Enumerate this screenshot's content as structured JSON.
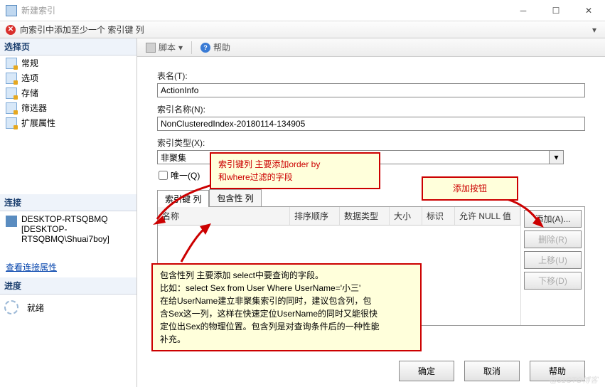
{
  "titlebar": {
    "title": "新建索引"
  },
  "error": {
    "message": "向索引中添加至少一个 索引键 列"
  },
  "sidebar": {
    "select_header": "选择页",
    "items": [
      "常规",
      "选项",
      "存储",
      "筛选器",
      "扩展属性"
    ],
    "conn_header": "连接",
    "conn_machine": "DESKTOP-RTSQBMQ",
    "conn_auth": "[DESKTOP-RTSQBMQ\\Shuai7boy]",
    "conn_link": "查看连接属性",
    "progress_header": "进度",
    "progress_status": "就绪"
  },
  "toolbar": {
    "script": "脚本",
    "help": "帮助"
  },
  "form": {
    "table_label": "表名(T):",
    "table_value": "ActionInfo",
    "indexname_label": "索引名称(N):",
    "indexname_value": "NonClusteredIndex-20180114-134905",
    "indextype_label": "索引类型(X):",
    "indextype_value": "非聚集",
    "unique_label": "唯一(Q)"
  },
  "tabs": {
    "tab1": "索引键 列",
    "tab2": "包含性 列"
  },
  "grid": {
    "cols": {
      "name": "名称",
      "sort": "排序顺序",
      "dtype": "数据类型",
      "size": "大小",
      "ident": "标识",
      "nullable": "允许 NULL 值"
    },
    "buttons": {
      "add": "添加(A)...",
      "remove": "删除(R)",
      "up": "上移(U)",
      "down": "下移(D)"
    }
  },
  "dialog_buttons": {
    "ok": "确定",
    "cancel": "取消",
    "help": "帮助"
  },
  "annotations": {
    "a1_l1": "索引键列 主要添加order by",
    "a1_l2": "和where过滤的字段",
    "a2": "添加按钮",
    "a3_l1": "包含性列 主要添加 select中要查询的字段。",
    "a3_l2": "比如：select Sex from User Where UserName='小三'",
    "a3_l3": "在给UserName建立非聚集索引的同时，建议包含列，包",
    "a3_l4": "含Sex这一列，这样在快速定位UserName的同时又能很快",
    "a3_l5": "定位出Sex的物理位置。包含列是对查询条件后的一种性能",
    "a3_l6": "补充。"
  },
  "watermark": "@51CTO博客"
}
